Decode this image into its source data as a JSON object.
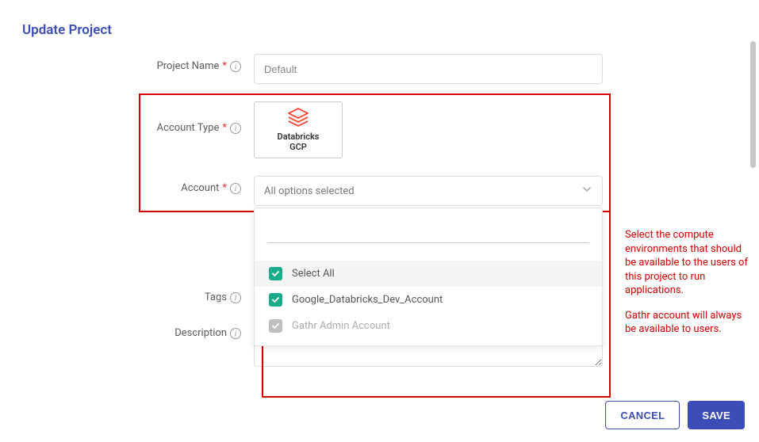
{
  "title": "Update Project",
  "form": {
    "projectName": {
      "label": "Project Name",
      "value": "Default"
    },
    "accountType": {
      "label": "Account Type",
      "card": {
        "name": "Databricks GCP"
      }
    },
    "account": {
      "label": "Account",
      "selected_text": "All options selected",
      "options": [
        {
          "label": "Select All",
          "checked": true,
          "disabled": false
        },
        {
          "label": "Google_Databricks_Dev_Account",
          "checked": true,
          "disabled": false
        },
        {
          "label": "Gathr Admin Account",
          "checked": true,
          "disabled": true
        }
      ]
    },
    "tags": {
      "label": "Tags"
    },
    "description": {
      "label": "Description"
    }
  },
  "annotation": {
    "p1": "Select the compute environments that should be available to the users of this project to run applications.",
    "p2": "Gathr account will always be available to users."
  },
  "buttons": {
    "cancel": "CANCEL",
    "save": "SAVE"
  }
}
